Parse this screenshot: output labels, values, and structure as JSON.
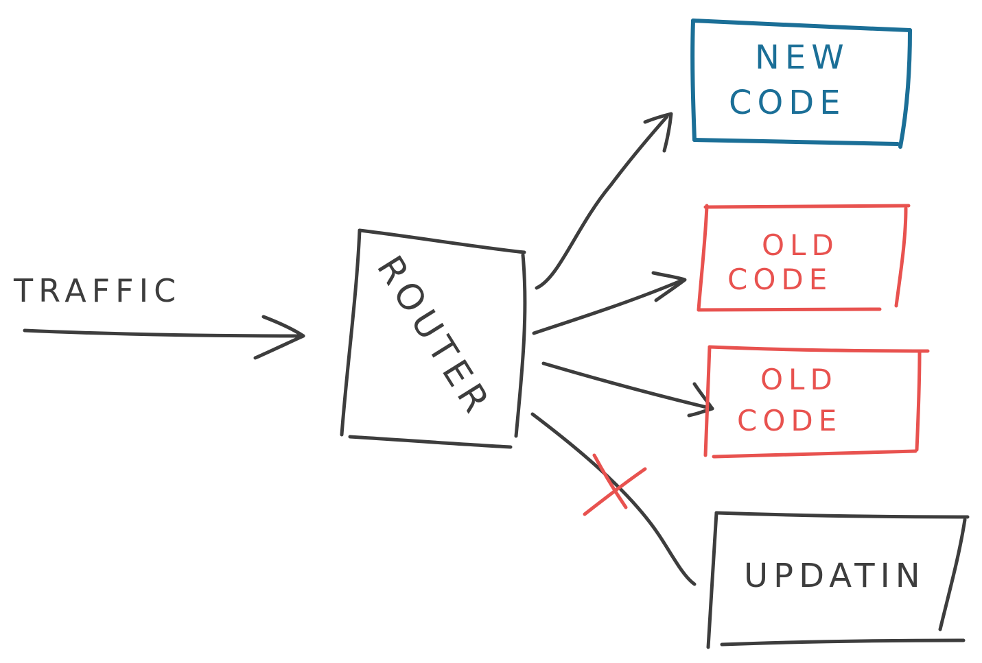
{
  "diagram": {
    "traffic_label": "TRAFFIC",
    "router_label": "ROUTER",
    "new_code": {
      "line1": "NEW",
      "line2": "CODE"
    },
    "old_code_1": {
      "line1": "OLD",
      "line2": "CODE"
    },
    "old_code_2": {
      "line1": "OLD",
      "line2": "CODE"
    },
    "updating_label": "UPDATIN",
    "colors": {
      "ink": "#3d3d3d",
      "new_code": "#1b6f97",
      "old_code": "#e8524f",
      "blocked_marker": "#e8524f"
    },
    "icons": {
      "blocked": "x-mark"
    }
  }
}
